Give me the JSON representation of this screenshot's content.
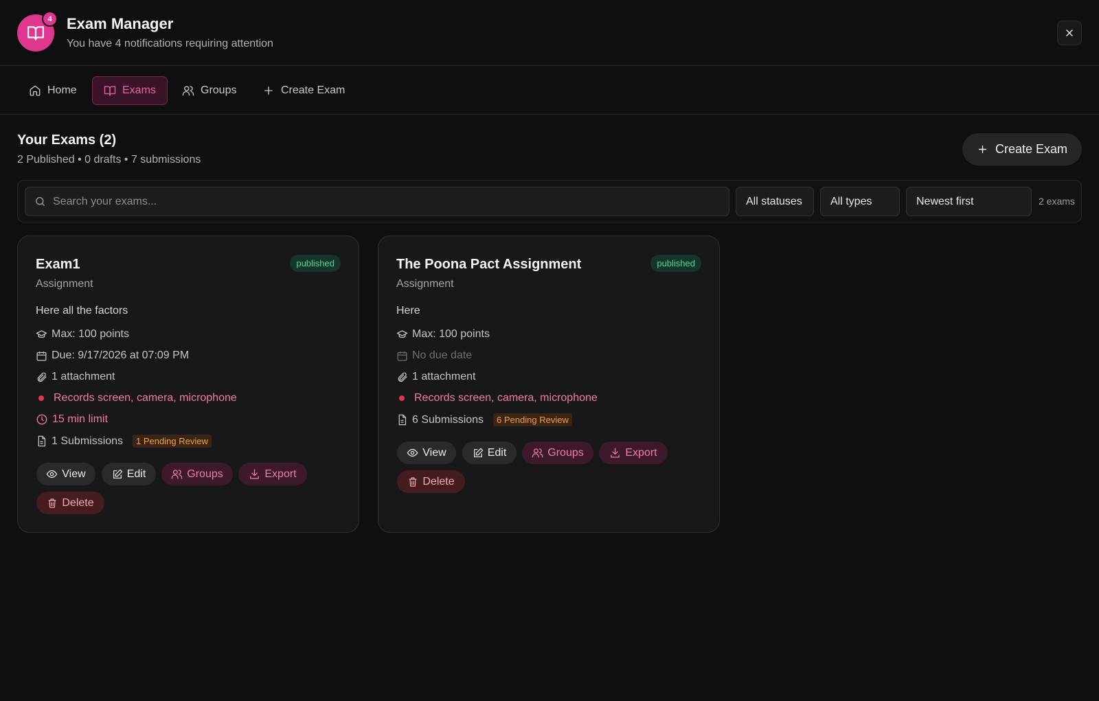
{
  "header": {
    "title": "Exam Manager",
    "subtitle": "You have 4 notifications requiring attention",
    "notification_count": "4",
    "accent_color": "#e0368e"
  },
  "tabs": [
    {
      "label": "Home",
      "icon": "home-icon",
      "active": false
    },
    {
      "label": "Exams",
      "icon": "book-icon",
      "active": true
    },
    {
      "label": "Groups",
      "icon": "users-icon",
      "active": false
    },
    {
      "label": "Create Exam",
      "icon": "plus-icon",
      "active": false
    }
  ],
  "section": {
    "title": "Your Exams (2)",
    "meta": "2 Published • 0 drafts • 7 submissions",
    "create_label": "Create Exam"
  },
  "filters": {
    "search_placeholder": "Search your exams...",
    "status": "All statuses",
    "type": "All types",
    "sort": "Newest first",
    "count": "2 exams"
  },
  "exams": [
    {
      "title": "Exam1",
      "type": "Assignment",
      "status": "published",
      "description": "Here all the factors",
      "max_points": "Max: 100 points",
      "due": "Due: 9/17/2026 at 07:09 PM",
      "attachments": "1 attachment",
      "proctoring": "Records screen, camera, microphone",
      "time_limit": "15 min limit",
      "submissions": "1 Submissions",
      "pending": "1 Pending Review",
      "actions": {
        "view": "View",
        "edit": "Edit",
        "groups": "Groups",
        "export": "Export",
        "delete": "Delete"
      }
    },
    {
      "title": "The Poona Pact Assignment",
      "type": "Assignment",
      "status": "published",
      "description": "Here",
      "max_points": "Max: 100 points",
      "due": "No due date",
      "attachments": "1 attachment",
      "proctoring": "Records screen, camera, microphone",
      "submissions": "6 Submissions",
      "pending": "6 Pending Review",
      "actions": {
        "view": "View",
        "edit": "Edit",
        "groups": "Groups",
        "export": "Export",
        "delete": "Delete"
      }
    }
  ]
}
